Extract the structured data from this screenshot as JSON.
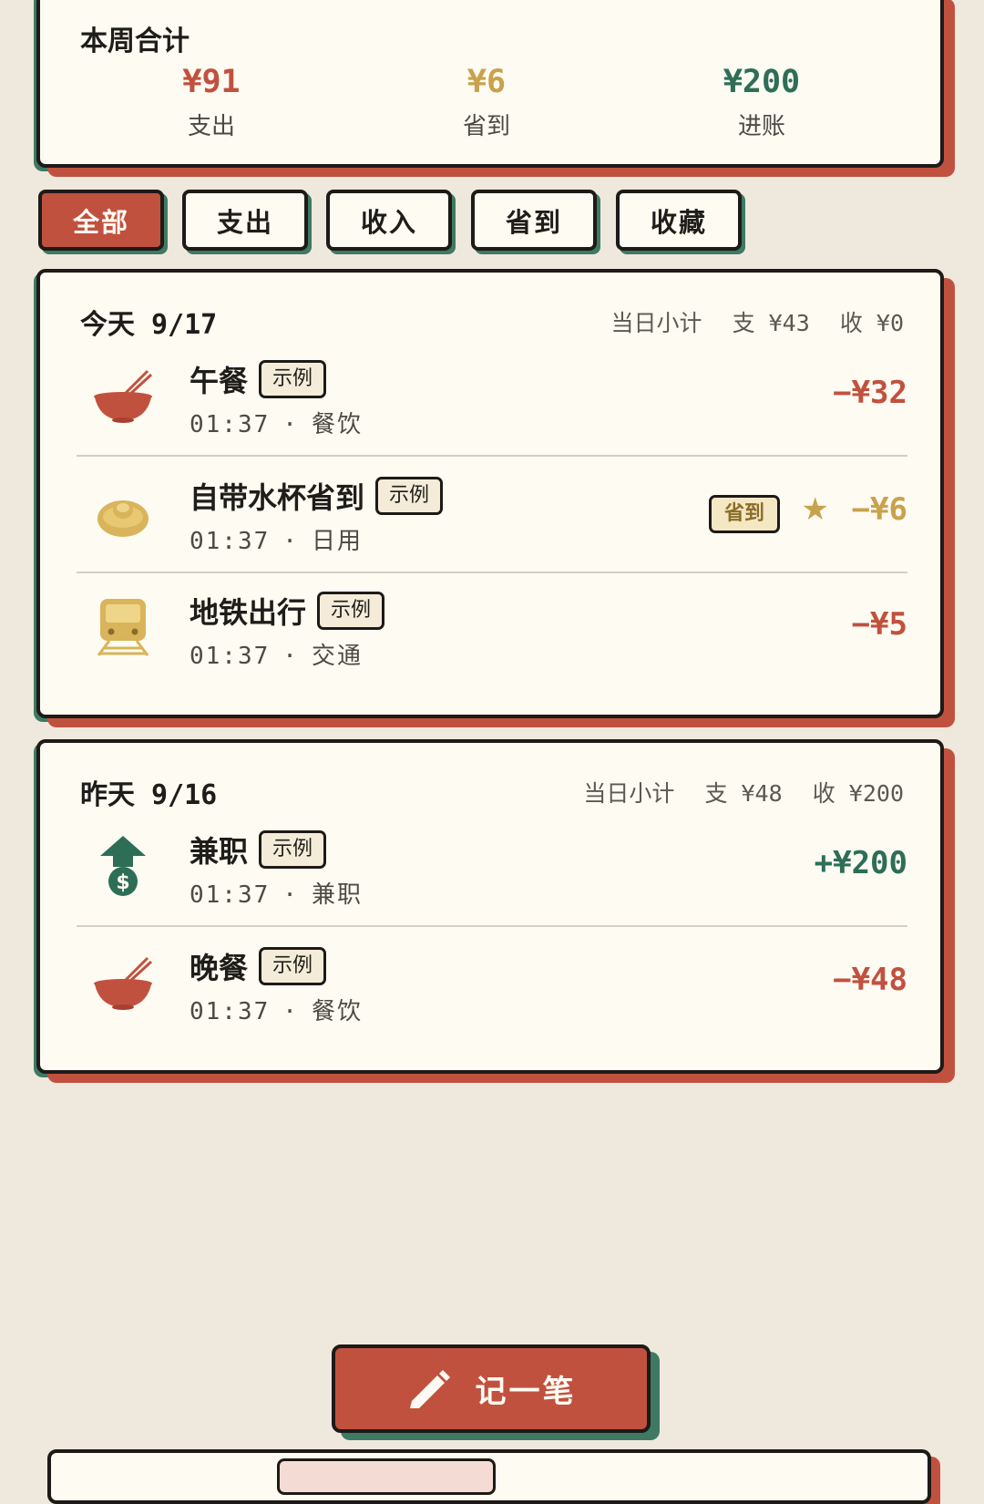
{
  "summary": {
    "title": "本周合计",
    "expense": {
      "value": "¥91",
      "label": "支出"
    },
    "saved": {
      "value": "¥6",
      "label": "省到"
    },
    "income": {
      "value": "¥200",
      "label": "进账"
    }
  },
  "tabs": [
    {
      "label": "全部",
      "active": true
    },
    {
      "label": "支出",
      "active": false
    },
    {
      "label": "收入",
      "active": false
    },
    {
      "label": "省到",
      "active": false
    },
    {
      "label": "收藏",
      "active": false
    }
  ],
  "days": [
    {
      "label": "今天",
      "date": "9/17",
      "subtotal_label": "当日小计",
      "expense": "支 ¥43",
      "income": "收 ¥0",
      "entries": [
        {
          "name": "午餐",
          "badge": "示例",
          "time": "01:37",
          "category": "餐饮",
          "amount": "−¥32",
          "icon": "bowl-icon",
          "amount_color": "#c1513f"
        },
        {
          "name": "自带水杯省到",
          "badge": "示例",
          "time": "01:37",
          "category": "日用",
          "amount": "−¥6",
          "icon": "ingot-icon",
          "tag": "省到",
          "starred": true,
          "amount_color": "#c8a24c"
        },
        {
          "name": "地铁出行",
          "badge": "示例",
          "time": "01:37",
          "category": "交通",
          "amount": "−¥5",
          "icon": "train-icon",
          "amount_color": "#c1513f"
        }
      ]
    },
    {
      "label": "昨天",
      "date": "9/16",
      "subtotal_label": "当日小计",
      "expense": "支 ¥48",
      "income": "收 ¥200",
      "entries": [
        {
          "name": "兼职",
          "badge": "示例",
          "time": "01:37",
          "category": "兼职",
          "amount": "+¥200",
          "icon": "money-up-icon",
          "amount_color": "#2e6e57"
        },
        {
          "name": "晚餐",
          "badge": "示例",
          "time": "01:37",
          "category": "餐饮",
          "amount": "−¥48",
          "icon": "bowl-icon",
          "amount_color": "#c1513f"
        }
      ]
    }
  ],
  "record_button": {
    "label": "记一笔",
    "icon": "pencil-icon"
  },
  "meta_separator": "·",
  "star_glyph": "★"
}
